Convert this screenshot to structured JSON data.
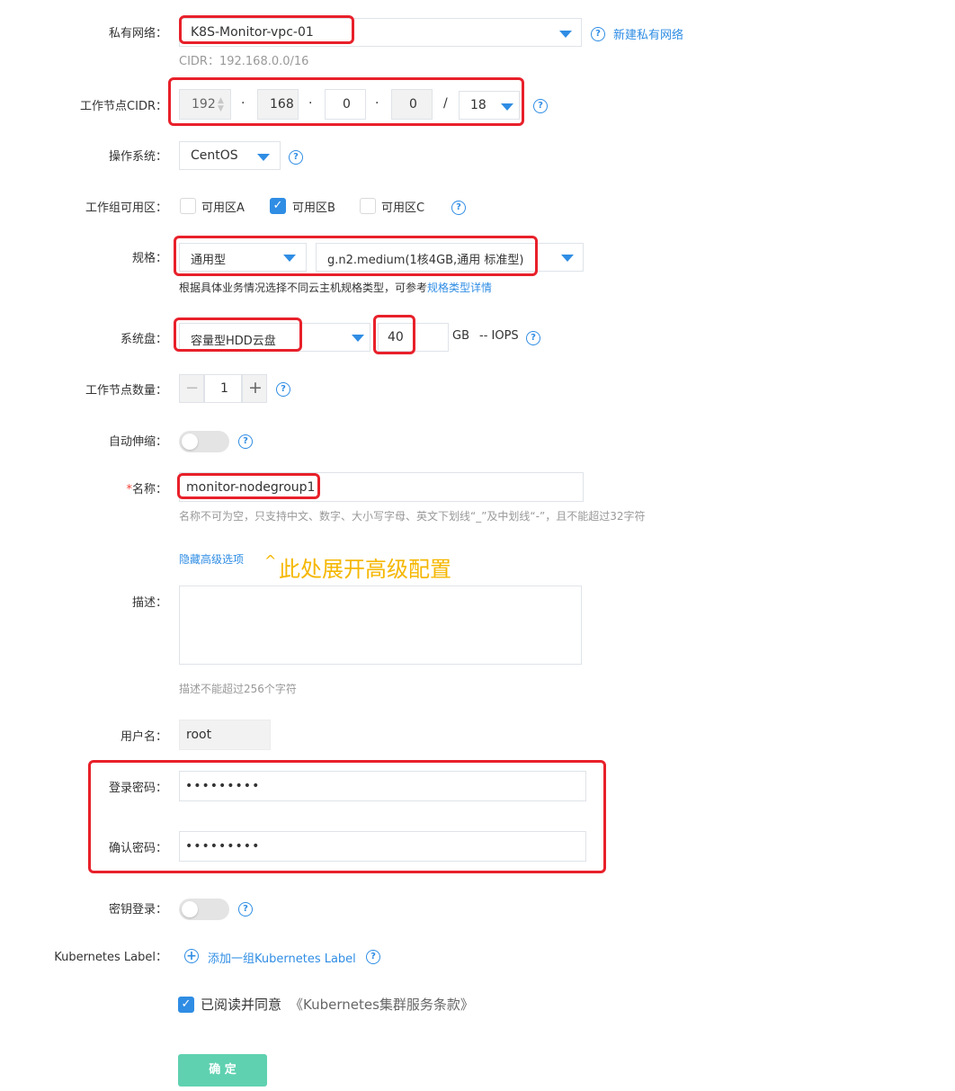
{
  "vpc": {
    "label": "私有网络：",
    "value": "K8S-Monitor-vpc-01",
    "new_link": "新建私有网络",
    "cidr_note": "CIDR：192.168.0.0/16"
  },
  "node_cidr": {
    "label": "工作节点CIDR：",
    "octets": [
      "192",
      "168",
      "0",
      "0"
    ],
    "dot": "·",
    "slash": "/",
    "mask": "18"
  },
  "os": {
    "label": "操作系统：",
    "value": "CentOS"
  },
  "zones": {
    "label": "工作组可用区：",
    "items": [
      {
        "label": "可用区A",
        "checked": false
      },
      {
        "label": "可用区B",
        "checked": true
      },
      {
        "label": "可用区C",
        "checked": false
      }
    ]
  },
  "spec": {
    "label": "规格：",
    "family": "通用型",
    "type": "g.n2.medium(1核4GB,通用 标准型)",
    "hint_prefix": "根据具体业务情况选择不同云主机规格类型，可参考",
    "hint_link": "规格类型详情"
  },
  "disk": {
    "label": "系统盘：",
    "type": "容量型HDD云盘",
    "size": "40",
    "unit": "GB",
    "iops": "-- IOPS"
  },
  "node_count": {
    "label": "工作节点数量：",
    "minus": "−",
    "value": "1",
    "plus": "+"
  },
  "autoscale": {
    "label": "自动伸缩："
  },
  "name": {
    "required_mark": "*",
    "label": "名称：",
    "value": "monitor-nodegroup1",
    "hint": "名称不可为空，只支持中文、数字、大小写字母、英文下划线“_”及中划线“-”，且不能超过32字符"
  },
  "advanced": {
    "toggle_link": "隐藏高级选项",
    "chevron": "^",
    "annotation": "此处展开高级配置"
  },
  "description": {
    "label": "描述：",
    "hint": "描述不能超过256个字符"
  },
  "username": {
    "label": "用户名：",
    "value": "root"
  },
  "password": {
    "label": "登录密码：",
    "value": "•••••••••"
  },
  "confirm_password": {
    "label": "确认密码：",
    "value": "•••••••••"
  },
  "key_login": {
    "label": "密钥登录："
  },
  "k8s_label": {
    "label": "Kubernetes Label：",
    "add_link": "添加一组Kubernetes Label"
  },
  "agreement": {
    "text": "已阅读并同意",
    "link": "《Kubernetes集群服务条款》",
    "checked": true
  },
  "submit": {
    "label": "确 定"
  },
  "colors": {
    "accent": "#2f8de4",
    "highlight": "#e8202a",
    "submit_bg": "#5fd1b0",
    "annotation": "#f5b700"
  }
}
